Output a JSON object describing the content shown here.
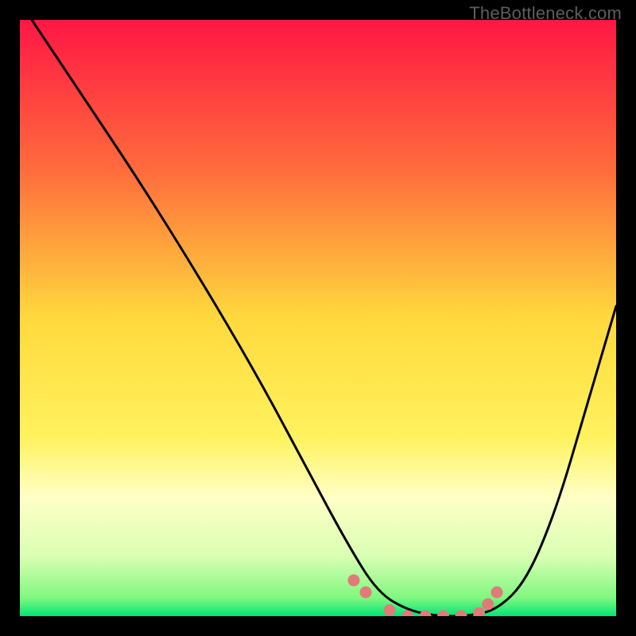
{
  "watermark": "TheBottleneck.com",
  "colors": {
    "background": "#000000",
    "watermark_text": "#5d5d5d",
    "curve": "#000000",
    "markers": "#e07b78"
  },
  "chart_data": {
    "type": "line",
    "title": "",
    "xlabel": "",
    "ylabel": "",
    "xlim": [
      0,
      100
    ],
    "ylim": [
      0,
      100
    ],
    "gradient_stops": [
      {
        "offset": 0,
        "color": "#ff1744"
      },
      {
        "offset": 0.25,
        "color": "#ff6b3d"
      },
      {
        "offset": 0.5,
        "color": "#ffd93d"
      },
      {
        "offset": 0.7,
        "color": "#fff25e"
      },
      {
        "offset": 0.8,
        "color": "#ffffc5"
      },
      {
        "offset": 0.9,
        "color": "#d9ffb3"
      },
      {
        "offset": 0.97,
        "color": "#7ff77f"
      },
      {
        "offset": 1.0,
        "color": "#00e676"
      }
    ],
    "series": [
      {
        "name": "bottleneck-curve",
        "x": [
          2,
          10,
          20,
          30,
          40,
          48,
          55,
          60,
          65,
          70,
          75,
          80,
          85,
          90,
          95,
          100
        ],
        "y": [
          100,
          88,
          73,
          57,
          40,
          25,
          12,
          4,
          1,
          0,
          0,
          1,
          6,
          18,
          35,
          52
        ]
      }
    ],
    "markers": {
      "name": "optimal-region",
      "x": [
        56,
        58,
        62,
        65,
        68,
        71,
        74,
        77,
        78.5,
        80
      ],
      "y": [
        6,
        4,
        1,
        0,
        0,
        0,
        0,
        0.5,
        2,
        4
      ]
    }
  }
}
